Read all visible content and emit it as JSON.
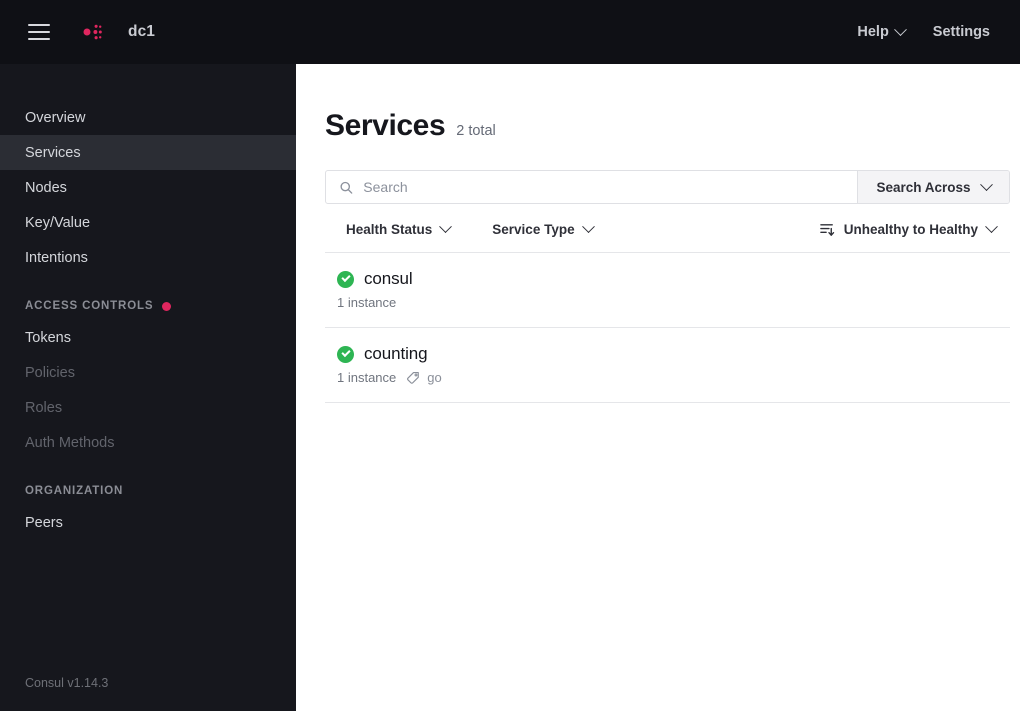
{
  "topbar": {
    "menu_icon": "hamburger-menu-icon",
    "logo_icon": "consul-logo-icon",
    "datacenter": "dc1",
    "help_label": "Help",
    "settings_label": "Settings"
  },
  "sidebar": {
    "items": [
      {
        "label": "Overview",
        "state": "normal"
      },
      {
        "label": "Services",
        "state": "active"
      },
      {
        "label": "Nodes",
        "state": "normal"
      },
      {
        "label": "Key/Value",
        "state": "normal"
      },
      {
        "label": "Intentions",
        "state": "normal"
      }
    ],
    "sections": [
      {
        "title": "ACCESS CONTROLS",
        "has_dot": true,
        "dot_color": "#e0265f",
        "items": [
          {
            "label": "Tokens",
            "state": "normal"
          },
          {
            "label": "Policies",
            "state": "disabled"
          },
          {
            "label": "Roles",
            "state": "disabled"
          },
          {
            "label": "Auth Methods",
            "state": "disabled"
          }
        ]
      },
      {
        "title": "ORGANIZATION",
        "has_dot": false,
        "items": [
          {
            "label": "Peers",
            "state": "normal"
          }
        ]
      }
    ],
    "version": "Consul v1.14.3"
  },
  "main": {
    "title": "Services",
    "count_label": "2 total",
    "search": {
      "placeholder": "Search",
      "value": "",
      "icon": "search-icon",
      "across_label": "Search Across"
    },
    "filters": [
      {
        "label": "Health Status"
      },
      {
        "label": "Service Type"
      }
    ],
    "sort": {
      "icon": "sort-descending-icon",
      "label": "Unhealthy to Healthy"
    },
    "services": [
      {
        "name": "consul",
        "health": "passing",
        "health_color": "#2eb553",
        "instances": "1 instance",
        "tags": []
      },
      {
        "name": "counting",
        "health": "passing",
        "health_color": "#2eb553",
        "instances": "1 instance",
        "tags": [
          "go"
        ]
      }
    ]
  },
  "colors": {
    "brand_pink": "#e0265f",
    "topbar_bg": "#0f1015",
    "sidebar_bg": "#16171d",
    "sidebar_active_bg": "#2b2d34",
    "health_green": "#2eb553"
  }
}
